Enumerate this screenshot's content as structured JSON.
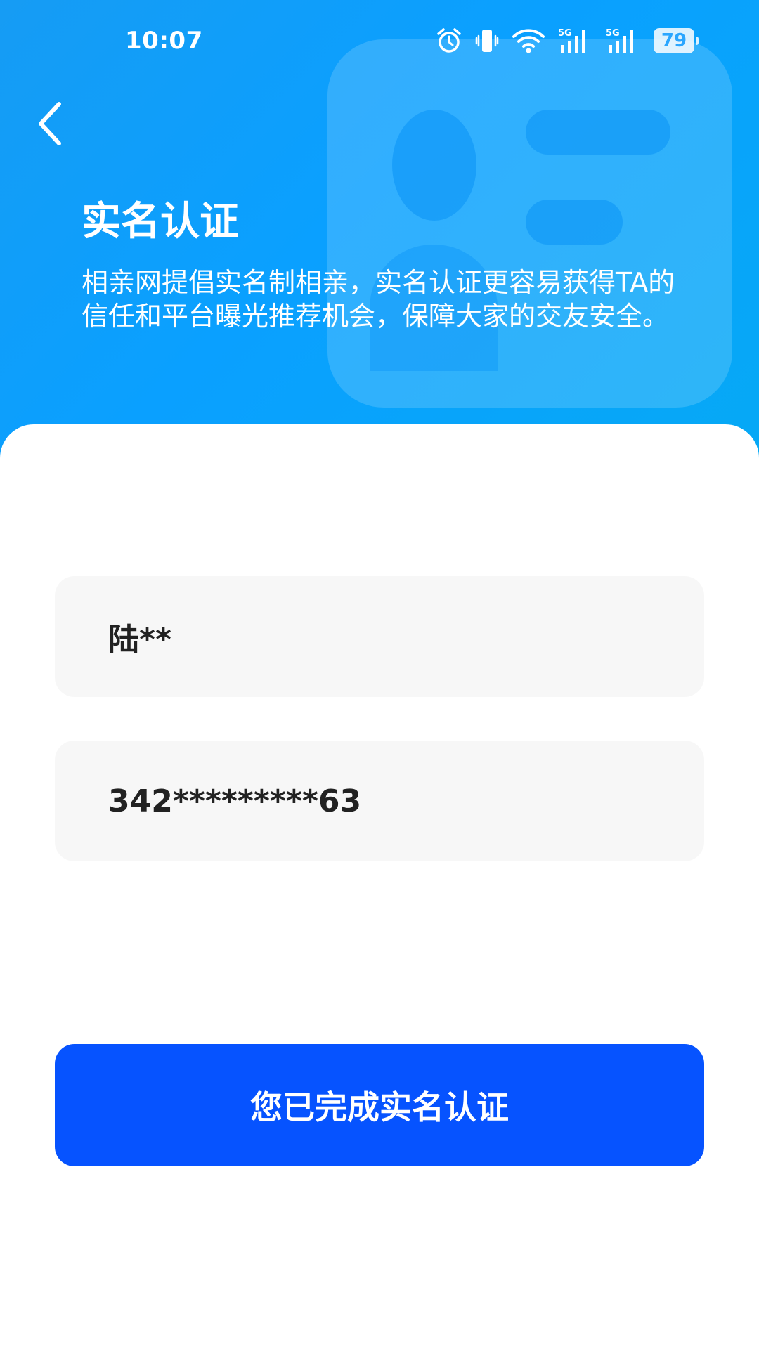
{
  "status_bar": {
    "time": "10:07",
    "battery": "79",
    "signal_label_1": "5G",
    "signal_label_2": "5G",
    "icons": [
      "alarm-icon",
      "vibrate-icon",
      "wifi-icon",
      "signal-5g-icon",
      "signal-5g-icon",
      "battery-icon"
    ]
  },
  "header": {
    "back_icon": "chevron-left-icon",
    "title": "实名认证",
    "description": "相亲网提倡实名制相亲，实名认证更容易获得TA的信任和平台曝光推荐机会，保障大家的交友安全。"
  },
  "form": {
    "name_value": "陆**",
    "id_number_value": "342*********63"
  },
  "actions": {
    "submit_label": "您已完成实名认证"
  },
  "colors": {
    "header_gradient_start": "#169cf4",
    "header_gradient_end": "#06a9f5",
    "primary_button": "#0653ff",
    "field_background": "#f7f7f7"
  }
}
